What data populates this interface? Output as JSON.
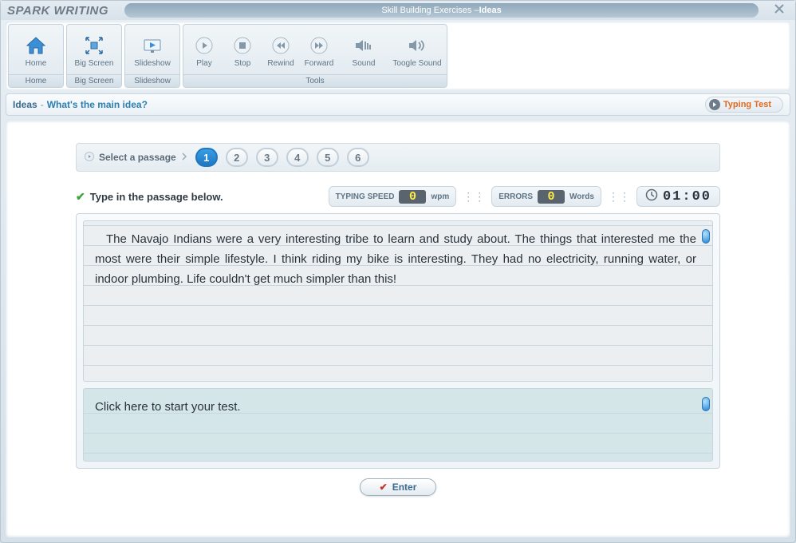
{
  "app_title": "SPARK WRITING",
  "title_pill_prefix": "Skill Building Exercises  –  ",
  "title_pill_topic": "Ideas",
  "toolbar": {
    "home": "Home",
    "big_screen": "Big Screen",
    "slideshow": "Slideshow",
    "play": "Play",
    "stop": "Stop",
    "rewind": "Rewind",
    "forward": "Forward",
    "sound": "Sound",
    "toggle_sound": "Toogle Sound",
    "tools_group": "Tools"
  },
  "breadcrumb": {
    "section": "Ideas",
    "question": "What's the main idea?",
    "typing_test": "Typing Test"
  },
  "selector": {
    "label": "Select a passage",
    "numbers": [
      "1",
      "2",
      "3",
      "4",
      "5",
      "6"
    ],
    "active": "1"
  },
  "instruction": "Type in the passage below.",
  "stats": {
    "speed_label": "TYPING SPEED",
    "speed_value": "0",
    "speed_unit": "wpm",
    "errors_label": "ERRORS",
    "errors_value": "0",
    "errors_unit": "Words",
    "timer": "01:00"
  },
  "passage_text": "The Navajo Indians were a very interesting tribe to learn and study about. The things that interested me the most were their simple lifestyle. I think riding my bike is interesting. They had no electricity, running water, or indoor plumbing. Life couldn't get much simpler than this!",
  "typing_placeholder": "Click here to start your test.",
  "enter_label": "Enter"
}
